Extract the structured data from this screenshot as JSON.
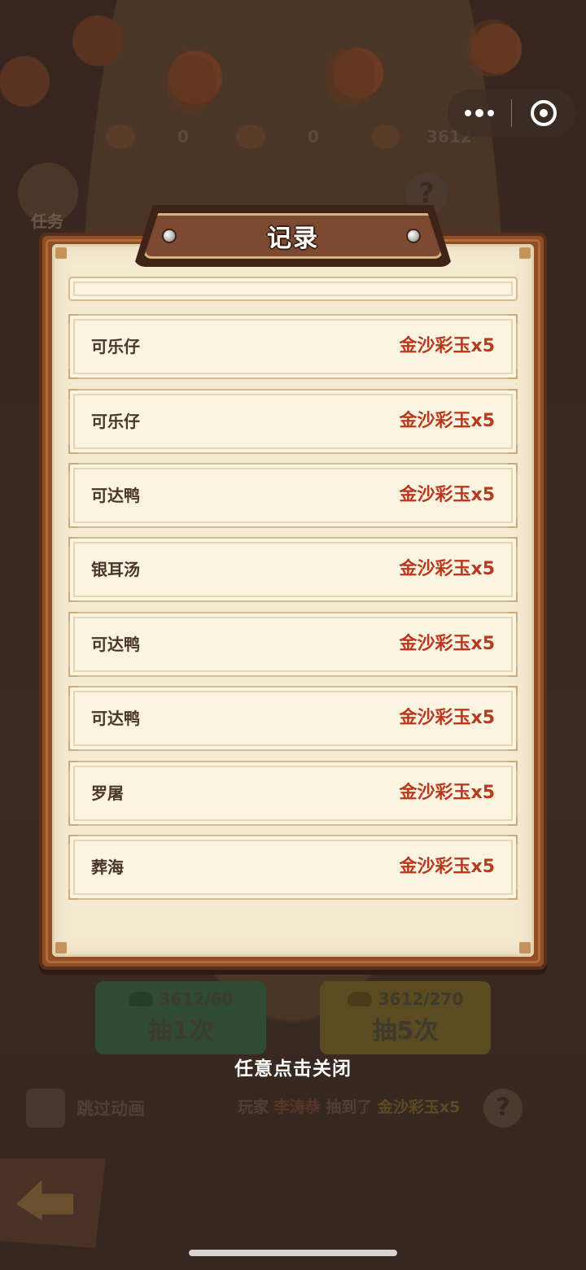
{
  "background": {
    "resources": [
      {
        "icon": "gem-icon",
        "value": "0"
      },
      {
        "icon": "coin-pouch-icon",
        "value": "0"
      },
      {
        "icon": "gold-ingot-icon",
        "value": "3612"
      }
    ],
    "task_label": "任务",
    "draw_once": {
      "cost": "3612/60",
      "label": "抽1次"
    },
    "draw_five": {
      "cost": "3612/270",
      "label": "抽5次"
    },
    "skip_animation": "跳过动画",
    "ticker": {
      "prefix": "玩家",
      "player": "李涛恭",
      "verb": "抽到了",
      "prize": "金沙彩玉x5"
    }
  },
  "modal": {
    "title": "记录",
    "records": [
      {
        "player": "可乐仔",
        "prize": "金沙彩玉x5"
      },
      {
        "player": "可乐仔",
        "prize": "金沙彩玉x5"
      },
      {
        "player": "可达鸭",
        "prize": "金沙彩玉x5"
      },
      {
        "player": "银耳汤",
        "prize": "金沙彩玉x5"
      },
      {
        "player": "可达鸭",
        "prize": "金沙彩玉x5"
      },
      {
        "player": "可达鸭",
        "prize": "金沙彩玉x5"
      },
      {
        "player": "罗屠",
        "prize": "金沙彩玉x5"
      },
      {
        "player": "葬海",
        "prize": "金沙彩玉x5"
      }
    ],
    "close_hint": "任意点击关闭"
  },
  "colors": {
    "prize_text": "#b8391f",
    "frame_wood": "#8e4e27",
    "parchment": "#f5ead2"
  }
}
